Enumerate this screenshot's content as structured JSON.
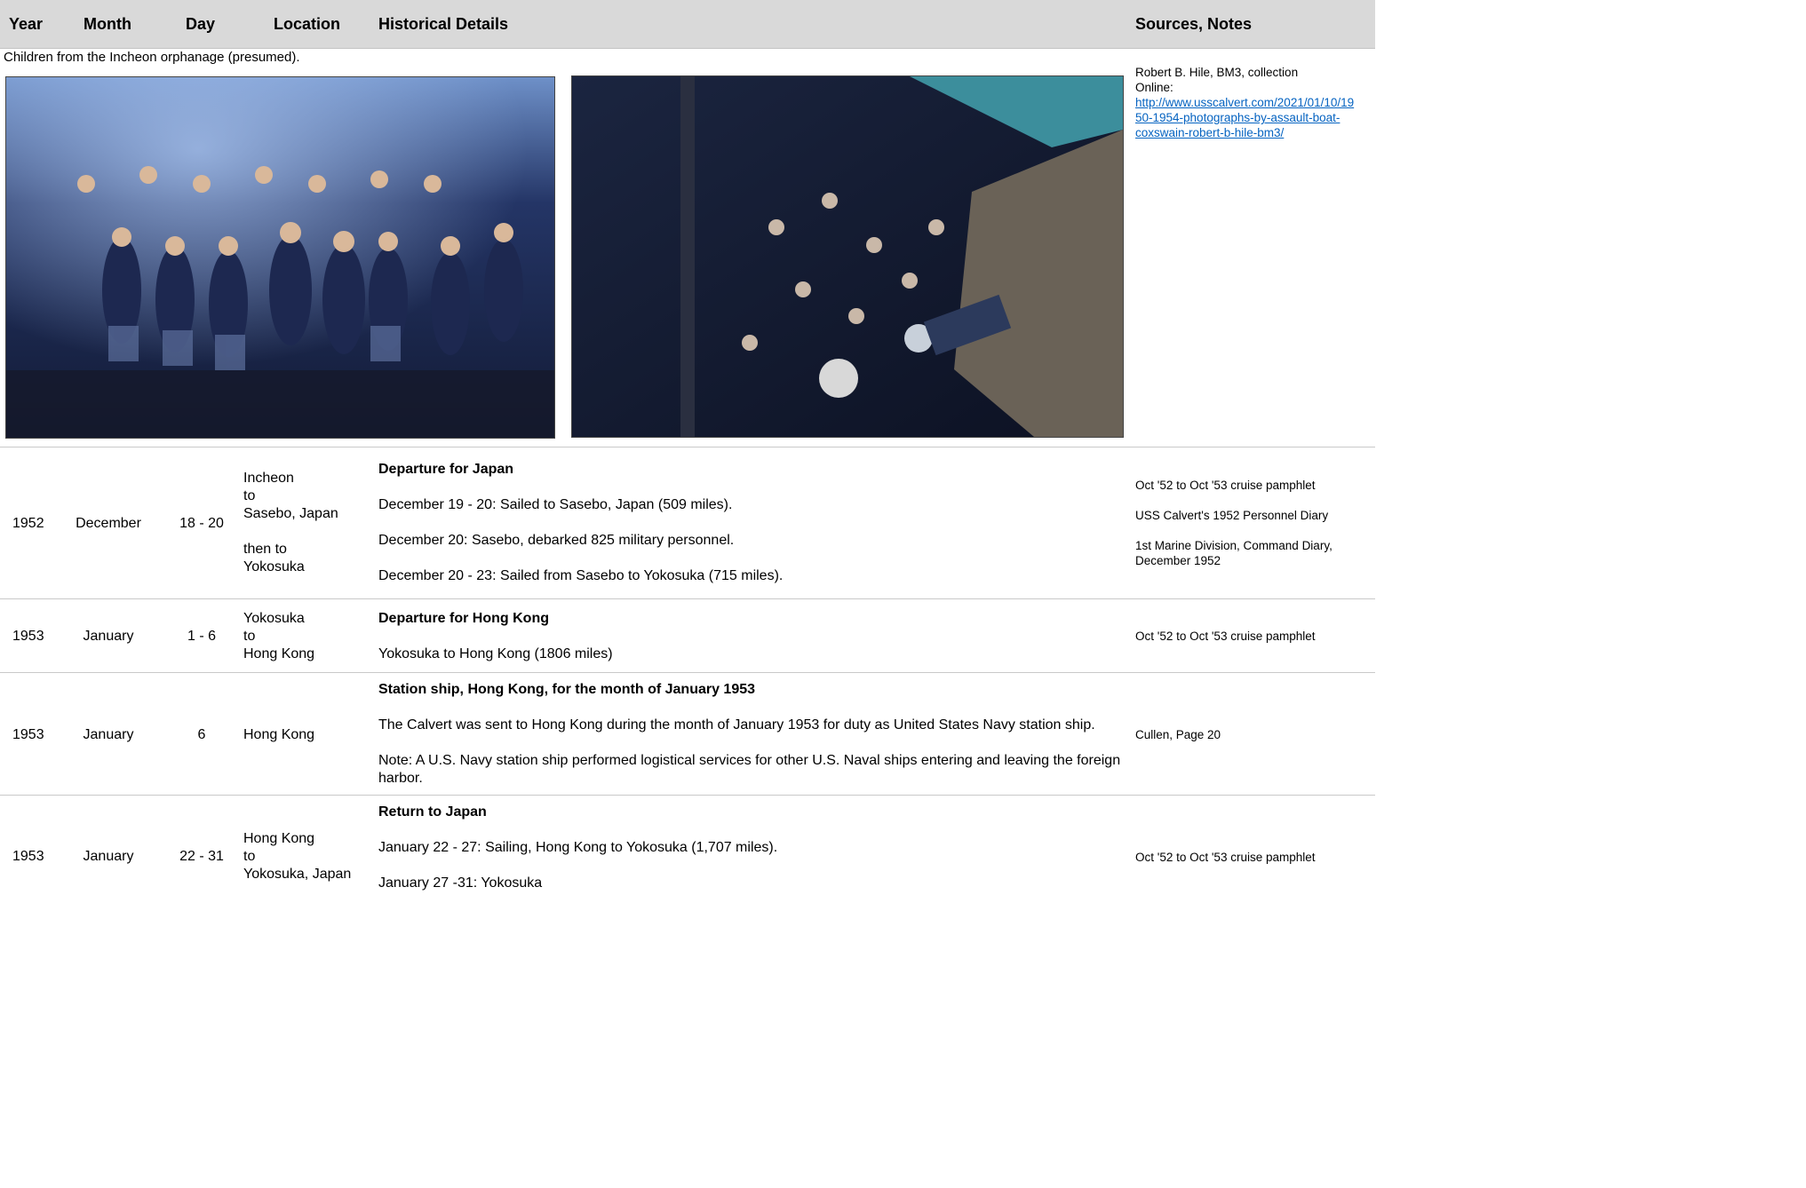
{
  "header": {
    "year": "Year",
    "month": "Month",
    "day": "Day",
    "location": "Location",
    "details": "Historical Details",
    "sources": "Sources, Notes"
  },
  "photo_section": {
    "caption": "Children from the Incheon orphanage (presumed).",
    "source_line1": "Robert B. Hile, BM3, collection",
    "source_line2": "Online:",
    "link_line1": "http://www.usscalvert.com/2021/01/10/19",
    "link_line2": "50-1954-photographs-by-assault-boat-",
    "link_line3": "coxswain-robert-b-hile-bm3/"
  },
  "rows": [
    {
      "year": "1952",
      "month": "December",
      "day": "18 - 20",
      "location": [
        "Incheon",
        "to",
        "Sasebo, Japan",
        "",
        "then to",
        "Yokosuka"
      ],
      "title": "Departure for Japan",
      "paras": [
        "December 19 - 20: Sailed to Sasebo, Japan (509 miles).",
        "December 20: Sasebo, debarked 825 military personnel.",
        "December 20 - 23: Sailed from Sasebo to Yokosuka (715 miles)."
      ],
      "sources": [
        "Oct '52 to Oct '53 cruise pamphlet",
        "USS Calvert's 1952 Personnel Diary",
        "1st Marine Division, Command Diary, December 1952"
      ]
    },
    {
      "year": "1953",
      "month": "January",
      "day": "1 - 6",
      "location": [
        "Yokosuka",
        "to",
        "Hong Kong"
      ],
      "title": "Departure for Hong Kong",
      "paras": [
        "Yokosuka to Hong Kong (1806 miles)"
      ],
      "sources": [
        "Oct '52 to Oct '53 cruise pamphlet"
      ]
    },
    {
      "year": "1953",
      "month": "January",
      "day": "6",
      "location": [
        "Hong Kong"
      ],
      "title": "Station ship, Hong Kong, for the month of January 1953",
      "paras": [
        "The Calvert was sent to Hong Kong during the month of January 1953 for duty as United States Navy station ship.",
        "Note: A U.S. Navy station ship performed logistical services for other U.S. Naval ships entering and leaving the foreign harbor."
      ],
      "sources": [
        "Cullen, Page 20"
      ]
    },
    {
      "year": "1953",
      "month": "January",
      "day": "22 - 31",
      "location": [
        "Hong Kong",
        "to",
        "Yokosuka, Japan"
      ],
      "title": "Return to Japan",
      "paras": [
        "January 22 - 27: Sailing, Hong Kong to Yokosuka (1,707 miles).",
        "January 27 -31: Yokosuka"
      ],
      "sources": [
        "Oct '52 to Oct '53 cruise pamphlet"
      ]
    }
  ]
}
